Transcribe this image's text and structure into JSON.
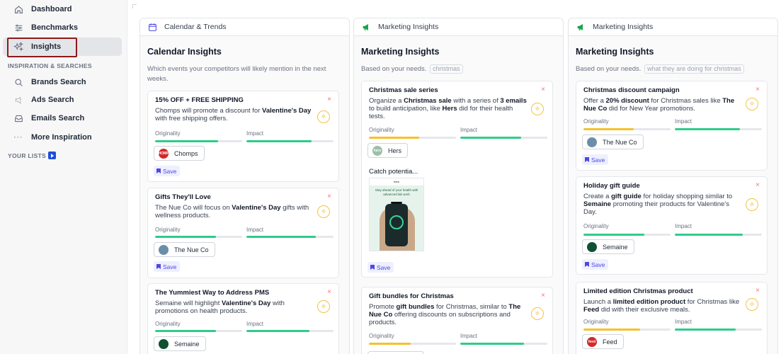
{
  "sidebar": {
    "items": [
      {
        "label": "Dashboard",
        "icon": "home-icon"
      },
      {
        "label": "Benchmarks",
        "icon": "sliders-icon"
      },
      {
        "label": "Insights",
        "icon": "sparkles-icon",
        "active": true
      },
      {
        "label": "Brands Search",
        "icon": "search-icon"
      },
      {
        "label": "Ads Search",
        "icon": "megaphone-icon"
      },
      {
        "label": "Emails Search",
        "icon": "inbox-icon"
      },
      {
        "label": "More Inspiration",
        "icon": "ellipsis-icon"
      }
    ],
    "section_inspiration": "INSPIRATION & SEARCHES",
    "section_lists": "YOUR LISTS"
  },
  "columns": [
    {
      "tab": "Calendar & Trends",
      "title": "Calendar Insights",
      "subtitle": "Which events your competitors will likely mention in the next weeks.",
      "cards": [
        {
          "title": "15% OFF + FREE SHIPPING",
          "desc_html": "Chomps will promote a discount for <b>Valentine's Day</b> with free shipping offers.",
          "originality": 0.72,
          "impact": 0.75,
          "brand": "Chomps",
          "save": "Save"
        },
        {
          "title": "Gifts They'll Love",
          "desc_html": "The Nue Co will focus on <b>Valentine's Day</b> gifts with wellness products.",
          "originality": 0.7,
          "impact": 0.8,
          "brand": "The Nue Co",
          "save": "Save"
        },
        {
          "title": "The Yummiest Way to Address PMS",
          "desc_html": "Semaine will highlight <b>Valentine's Day</b> with promotions on health products.",
          "originality": 0.7,
          "impact": 0.72,
          "brand": "Semaine"
        }
      ]
    },
    {
      "tab": "Marketing Insights",
      "title": "Marketing Insights",
      "subtitle_prefix": "Based on your needs.",
      "subtitle_chip": "christmas",
      "cards": [
        {
          "title": "Christmas sale series",
          "desc_html": "Organize a <b>Christmas sale</b> with a series of <b>3 emails</b> to build anticipation, like <b>Hers</b> did for their health tests.",
          "originality": 0.58,
          "impact": 0.7,
          "brand": "Hers",
          "catch": "Catch potentia...",
          "email_preview": {
            "brand": "hers",
            "headline": "Stay ahead of your health with advanced lab work"
          },
          "save": "Save"
        },
        {
          "title": "Gift bundles for Christmas",
          "desc_html": "Promote <b>gift bundles</b> for Christmas, similar to <b>The Nue Co</b> offering discounts on subscriptions and products.",
          "originality": 0.48,
          "impact": 0.73
        }
      ]
    },
    {
      "tab": "Marketing Insights",
      "title": "Marketing Insights",
      "subtitle_prefix": "Based on your needs.",
      "subtitle_chip": "what they are doing for christmas",
      "cards": [
        {
          "title": "Christmas discount campaign",
          "desc_html": "Offer a <b>20% discount</b> for Christmas sales like <b>The Nue Co</b> did for New Year promotions.",
          "originality": 0.58,
          "impact": 0.75,
          "brand": "The Nue Co",
          "save": "Save"
        },
        {
          "title": "Holiday gift guide",
          "desc_html": "Create a <b>gift guide</b> for holiday shopping similar to <b>Semaine</b> promoting their products for Valentine's Day.",
          "originality": 0.7,
          "impact": 0.78,
          "brand": "Semaine",
          "save": "Save"
        },
        {
          "title": "Limited edition Christmas product",
          "desc_html": "Launch a <b>limited edition product</b> for Christmas like <b>Feed</b> did with their exclusive meals.",
          "originality": 0.65,
          "impact": 0.7,
          "brand": "Feed"
        }
      ]
    }
  ],
  "labels": {
    "originality": "Originality",
    "impact": "Impact",
    "close": "×"
  },
  "colors": {
    "accent": "#4f46e5",
    "active_outline": "#8b1a1a",
    "originality_yellow": "#f6c12b",
    "impact_green": "#2ecc8a"
  }
}
